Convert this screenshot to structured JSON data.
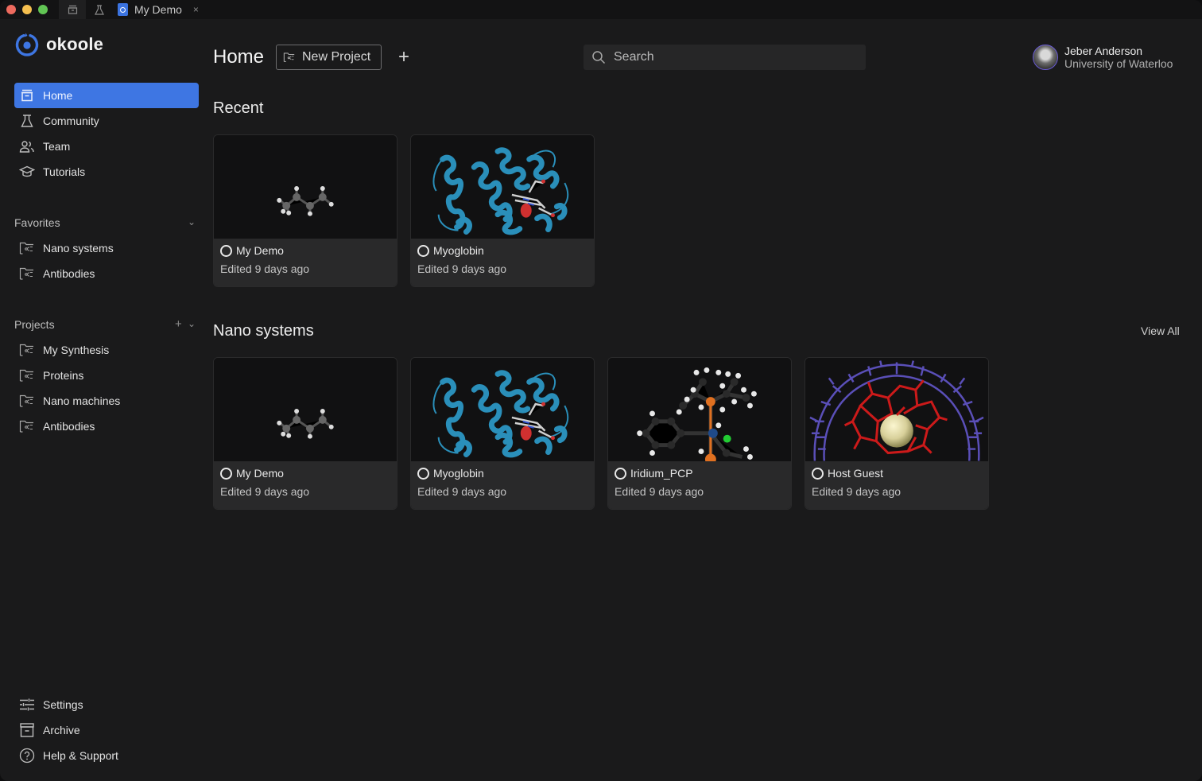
{
  "titlebar": {
    "tabs": [
      {
        "icon": "home-tab-icon"
      },
      {
        "icon": "community-tab-icon"
      }
    ],
    "document_tab": {
      "label": "My Demo",
      "close": "×"
    }
  },
  "sidebar": {
    "brand": "okoole",
    "nav": [
      {
        "label": "Home",
        "icon": "home-icon",
        "active": true
      },
      {
        "label": "Community",
        "icon": "flask-icon"
      },
      {
        "label": "Team",
        "icon": "team-icon"
      },
      {
        "label": "Tutorials",
        "icon": "graduation-cap-icon"
      }
    ],
    "favorites": {
      "label": "Favorites",
      "items": [
        {
          "label": "Nano systems",
          "icon": "project-folder-icon"
        },
        {
          "label": "Antibodies",
          "icon": "project-folder-icon"
        }
      ]
    },
    "projects": {
      "label": "Projects",
      "add": "+",
      "items": [
        {
          "label": "My Synthesis",
          "icon": "project-folder-icon"
        },
        {
          "label": "Proteins",
          "icon": "project-folder-icon"
        },
        {
          "label": "Nano machines",
          "icon": "project-folder-icon"
        },
        {
          "label": "Antibodies",
          "icon": "project-folder-icon"
        }
      ]
    },
    "footer": [
      {
        "label": "Settings",
        "icon": "sliders-icon"
      },
      {
        "label": "Archive",
        "icon": "archive-icon"
      },
      {
        "label": "Help & Support",
        "icon": "help-icon"
      }
    ]
  },
  "header": {
    "title": "Home",
    "new_project_label": "New Project",
    "add_label": "+",
    "search_placeholder": "Search",
    "user": {
      "name": "Jeber Anderson",
      "org": "University of Waterloo"
    }
  },
  "recent": {
    "title": "Recent",
    "cards": [
      {
        "name": "My Demo",
        "edited": "Edited 9 days ago",
        "thumb": "butane"
      },
      {
        "name": "Myoglobin",
        "edited": "Edited 9 days ago",
        "thumb": "protein"
      }
    ]
  },
  "nano_systems": {
    "title": "Nano systems",
    "view_all": "View All",
    "cards": [
      {
        "name": "My Demo",
        "edited": "Edited 9 days ago",
        "thumb": "butane"
      },
      {
        "name": "Myoglobin",
        "edited": "Edited 9 days ago",
        "thumb": "protein"
      },
      {
        "name": "Iridium_PCP",
        "edited": "Edited 9 days ago",
        "thumb": "iridium"
      },
      {
        "name": "Host Guest",
        "edited": "Edited 9 days ago",
        "thumb": "hostguest"
      }
    ]
  },
  "colors": {
    "accent": "#3e76e3",
    "background": "#1a1a1b",
    "card_info": "#29292a"
  }
}
